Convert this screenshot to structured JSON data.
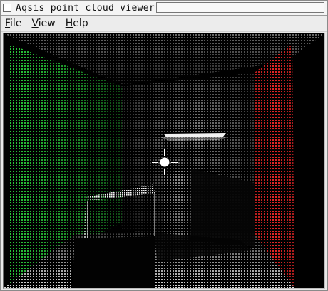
{
  "window": {
    "title": "Aqsis point cloud viewer"
  },
  "menu": {
    "items": [
      {
        "id": "file",
        "mnemonic": "F",
        "rest": "ile"
      },
      {
        "id": "view",
        "mnemonic": "V",
        "rest": "iew"
      },
      {
        "id": "help",
        "mnemonic": "H",
        "rest": "elp"
      }
    ]
  },
  "viewport": {
    "background": "#000000",
    "scene": "point cloud of a cornell box",
    "colors": {
      "left_wall": "#1fae2e",
      "right_wall": "#d21a1a",
      "neutral": "#d8d8d8"
    },
    "cursor_icon": "crosshair-light-icon"
  }
}
